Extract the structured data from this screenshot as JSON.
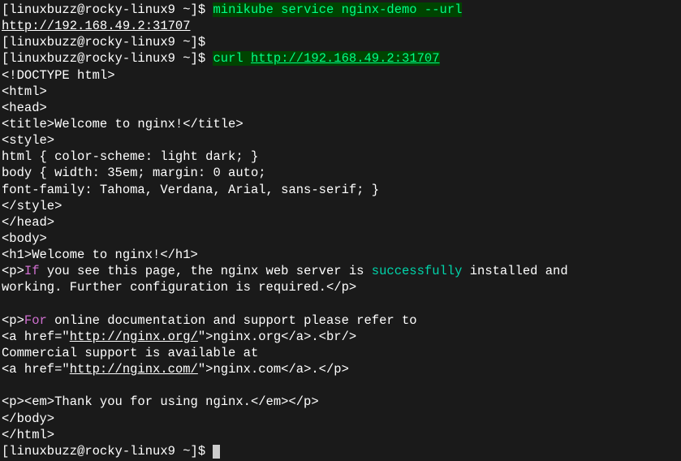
{
  "prompt": "[linuxbuzz@rocky-linux9 ~]$",
  "cmd1": "minikube service nginx-demo --url",
  "url1": "http://192.168.49.2:31707",
  "cmd2a": "curl ",
  "cmd2b": "http://192.168.49.2:31707",
  "out": {
    "l1": "<!DOCTYPE html>",
    "l2": "<html>",
    "l3": "<head>",
    "l4": "<title>Welcome to nginx!</title>",
    "l5": "<style>",
    "l6": "html { color-scheme: light dark; }",
    "l7": "body { width: 35em; margin: 0 auto;",
    "l8": "font-family: Tahoma, Verdana, Arial, sans-serif; }",
    "l9": "</style>",
    "l10": "</head>",
    "l11": "<body>",
    "l12": "<h1>Welcome to nginx!</h1>",
    "p1a": "<p>",
    "p1b": "If",
    "p1c": " you see this page, the nginx web server is ",
    "p1d": "successfully",
    "p1e": " installed and",
    "l14": "working. Further configuration is required.</p>",
    "p2a": "<p>",
    "p2b": "For",
    "p2c": " online documentation and support please refer to",
    "a1a": "<a href=\"",
    "a1b": "http://nginx.org/",
    "a1c": "\">nginx.org</a>.<br/>",
    "l17": "Commercial support is available at",
    "a2a": "<a href=\"",
    "a2b": "http://nginx.com/",
    "a2c": "\">nginx.com</a>.</p>",
    "l19": "<p><em>Thank you for using nginx.</em></p>",
    "l20": "</body>",
    "l21": "</html>"
  }
}
